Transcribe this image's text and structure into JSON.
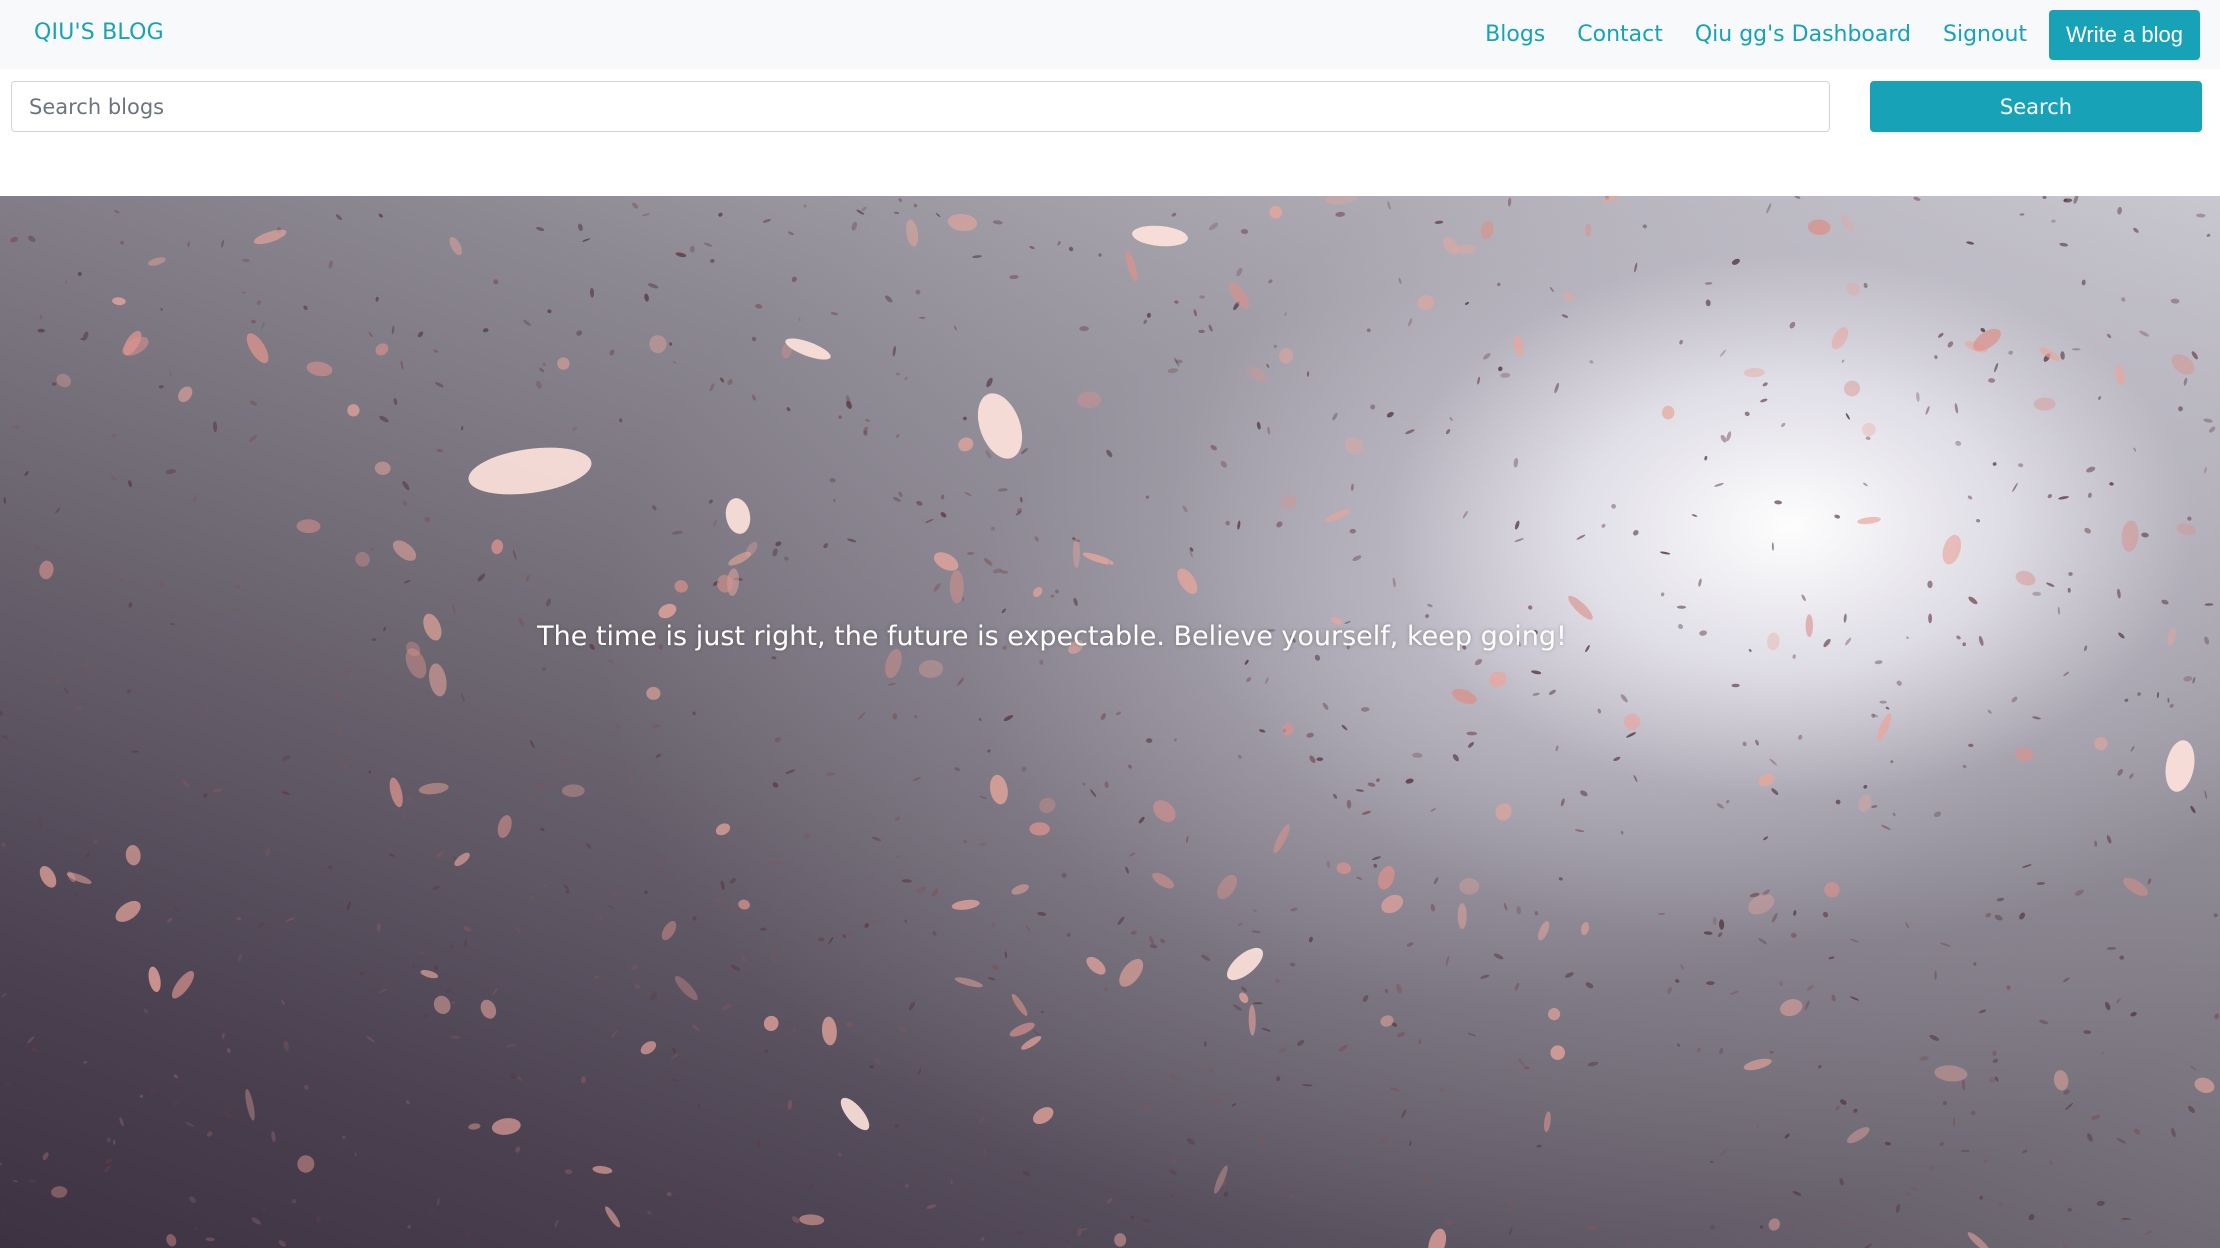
{
  "navbar": {
    "brand": "QIU'S BLOG",
    "links": [
      "Blogs",
      "Contact",
      "Qiu gg's Dashboard",
      "Signout"
    ],
    "write_button": "Write a blog"
  },
  "search": {
    "placeholder": "Search blogs",
    "value": "",
    "button_label": "Search"
  },
  "hero": {
    "tagline": "The time is just right, the future is expectable. Believe yourself, keep going!"
  },
  "colors": {
    "accent": "#17a2b8",
    "navbar_bg": "#f8f9fa"
  }
}
